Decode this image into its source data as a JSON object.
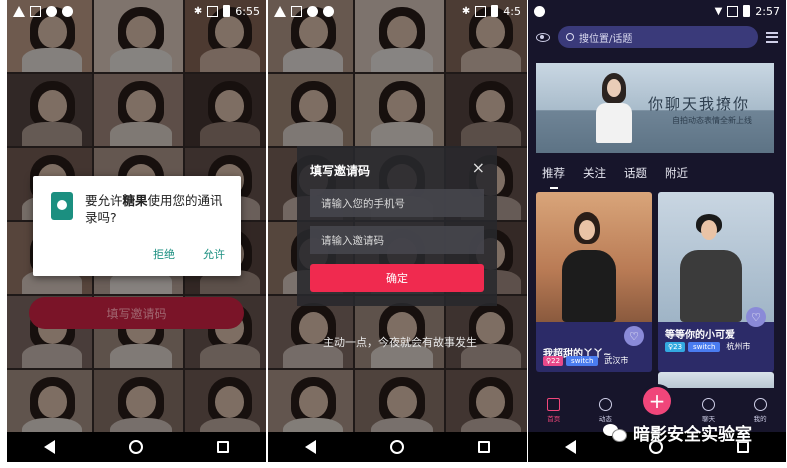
{
  "panel1": {
    "status": {
      "time": "6:55"
    },
    "permission_dialog": {
      "text_prefix": "要允许",
      "app_name": "糖果",
      "text_suffix": "使用您的通讯录吗?",
      "deny_label": "拒绝",
      "allow_label": "允许"
    },
    "fill_invite_label": "填写邀请码"
  },
  "panel2": {
    "status": {
      "time": "4:5"
    },
    "invite_dialog": {
      "title": "填写邀请码",
      "close_symbol": "×",
      "phone_placeholder": "请输入您的手机号",
      "code_placeholder": "请输入邀请码",
      "confirm_label": "确定"
    },
    "tagline": "主动一点，今夜就会有故事发生"
  },
  "panel3": {
    "status": {
      "time": "2:57"
    },
    "search_placeholder": "搜位置/话题",
    "banner": {
      "title": "你聊天我撩你",
      "subtitle": "自拍动态表情全新上线"
    },
    "tabs": [
      "推荐",
      "关注",
      "话题",
      "附近"
    ],
    "cards": [
      {
        "name": "我超甜的丫丫~",
        "age": "♀22",
        "device": "switch",
        "city": "武汉市"
      },
      {
        "name": "等等你的小可爱",
        "age": "♀23",
        "device": "switch",
        "city": "杭州市"
      }
    ],
    "nav": {
      "home": "首页",
      "moments": "动态",
      "plus": "+",
      "chat": "聊天",
      "me": "我的"
    }
  },
  "watermark": "暗影安全实验室",
  "colors": {
    "accent_pink": "#f0467a",
    "confirm_red": "#f02a4f",
    "dialog_teal": "#1b8f80",
    "app_bg": "#17152b",
    "search_bg": "#3a3a7a"
  }
}
